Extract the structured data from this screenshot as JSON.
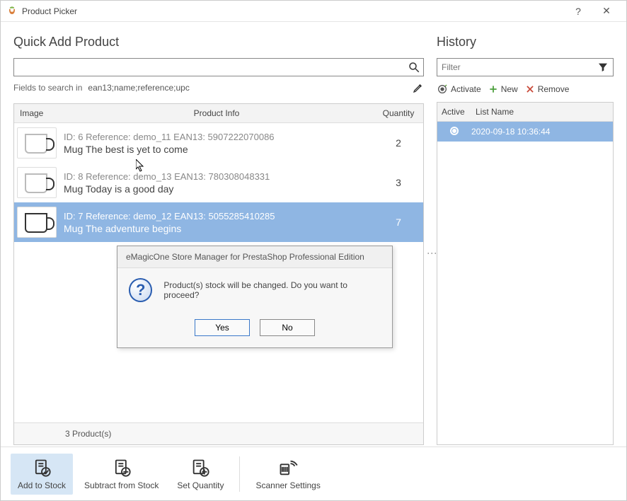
{
  "window": {
    "title": "Product Picker"
  },
  "left": {
    "heading": "Quick Add Product",
    "search_value": "",
    "fields_label": "Fields to search in",
    "fields_value": "ean13;name;reference;upc",
    "columns": {
      "image": "Image",
      "info": "Product Info",
      "qty": "Quantity"
    },
    "rows": [
      {
        "meta": "ID: 6 Reference: demo_11 EAN13: 5907222070086",
        "name": "Mug The best is yet to come",
        "qty": "2",
        "selected": false,
        "mug": "white"
      },
      {
        "meta": "ID: 8 Reference: demo_13 EAN13: 780308048331",
        "name": "Mug Today is a good day",
        "qty": "3",
        "selected": false,
        "mug": "white"
      },
      {
        "meta": "ID: 7 Reference: demo_12 EAN13: 5055285410285",
        "name": "Mug The adventure begins",
        "qty": "7",
        "selected": true,
        "mug": "black"
      }
    ],
    "footer": "3 Product(s)"
  },
  "right": {
    "heading": "History",
    "filter_placeholder": "Filter",
    "actions": {
      "activate": "Activate",
      "new": "New",
      "remove": "Remove"
    },
    "columns": {
      "active": "Active",
      "name": "List Name"
    },
    "rows": [
      {
        "name": "2020-09-18 10:36:44",
        "active": true
      }
    ]
  },
  "dialog": {
    "title": "eMagicOne Store Manager for PrestaShop Professional Edition",
    "message": "Product(s) stock will be changed. Do you want to proceed?",
    "yes": "Yes",
    "no": "No"
  },
  "bottom": {
    "add": "Add to Stock",
    "subtract": "Subtract from Stock",
    "setqty": "Set Quantity",
    "scanner": "Scanner Settings"
  }
}
